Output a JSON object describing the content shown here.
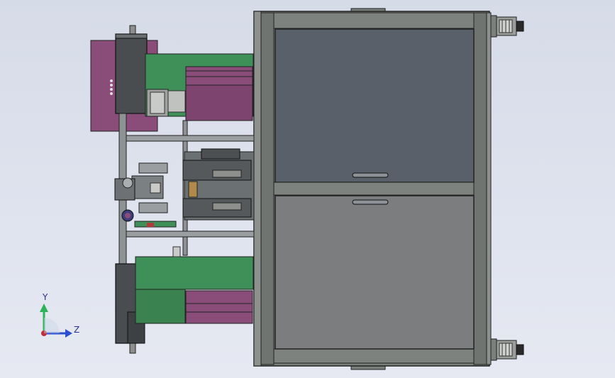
{
  "colors": {
    "background": "#dfe3ee",
    "frame": "#6e736f",
    "frame_dark": "#3b3f3e",
    "panel_dark": "#595f69",
    "panel_light": "#7a7c7d",
    "green": "#3f8f58",
    "purple": "#8a4d7a",
    "motor": "#4a4d50",
    "axis_y": "#2fb35a",
    "axis_z": "#2b4fd0",
    "axis_x": "#c0303a"
  },
  "triad": {
    "y_label": "Y",
    "z_label": "Z"
  }
}
